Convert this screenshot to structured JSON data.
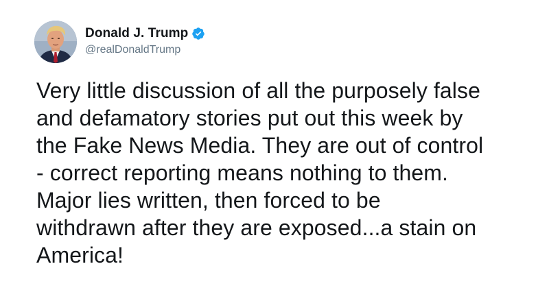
{
  "tweet": {
    "author": {
      "display_name": "Donald J. Trump",
      "handle": "@realDonaldTrump",
      "verified": true,
      "avatar_icon": "profile-photo"
    },
    "text": "Very little discussion of all the purposely false\nand defamatory stories put out this week by\nthe Fake News Media. They are out of control\n- correct reporting means nothing to them.\nMajor lies written, then forced to be\nwithdrawn after they are exposed...a stain on\nAmerica!"
  },
  "colors": {
    "text": "#14171a",
    "handle": "#657786",
    "verified_badge": "#1da1f2",
    "background": "#ffffff"
  }
}
